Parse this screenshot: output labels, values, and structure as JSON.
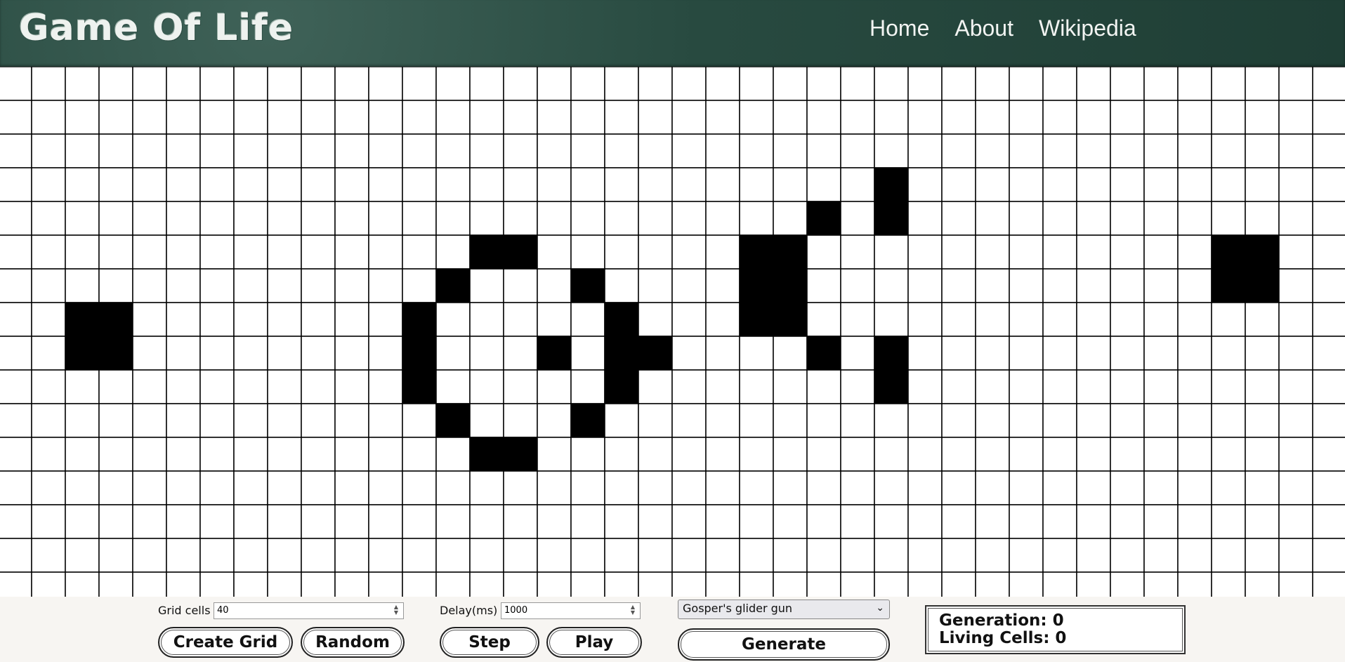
{
  "header": {
    "title": "Game Of Life",
    "nav": [
      "Home",
      "About",
      "Wikipedia"
    ]
  },
  "grid": {
    "columns": 40,
    "visible_rows": 16,
    "alive_color": "#000000",
    "dead_color": "#ffffff",
    "line_color": "#000000",
    "alive_cells": [
      [
        1,
        7
      ],
      [
        2,
        7
      ],
      [
        1,
        8
      ],
      [
        2,
        8
      ],
      [
        13,
        5
      ],
      [
        14,
        5
      ],
      [
        12,
        6
      ],
      [
        16,
        6
      ],
      [
        11,
        7
      ],
      [
        17,
        7
      ],
      [
        11,
        8
      ],
      [
        15,
        8
      ],
      [
        17,
        8
      ],
      [
        18,
        8
      ],
      [
        11,
        9
      ],
      [
        17,
        9
      ],
      [
        12,
        10
      ],
      [
        16,
        10
      ],
      [
        13,
        11
      ],
      [
        14,
        11
      ],
      [
        21,
        5
      ],
      [
        22,
        5
      ],
      [
        21,
        6
      ],
      [
        22,
        6
      ],
      [
        21,
        7
      ],
      [
        22,
        7
      ],
      [
        23,
        4
      ],
      [
        25,
        3
      ],
      [
        25,
        4
      ],
      [
        23,
        8
      ],
      [
        25,
        8
      ],
      [
        25,
        9
      ],
      [
        35,
        5
      ],
      [
        36,
        5
      ],
      [
        35,
        6
      ],
      [
        36,
        6
      ]
    ]
  },
  "controls": {
    "grid_cells_label": "Grid cells",
    "grid_cells_value": "40",
    "delay_label": "Delay(ms)",
    "delay_value": "1000",
    "create_grid_label": "Create Grid",
    "random_label": "Random",
    "step_label": "Step",
    "play_label": "Play",
    "pattern_selected": "Gosper's glider gun",
    "generate_label": "Generate"
  },
  "stats": {
    "generation_label": "Generation: 0",
    "living_cells_label": "Living Cells: 0"
  }
}
